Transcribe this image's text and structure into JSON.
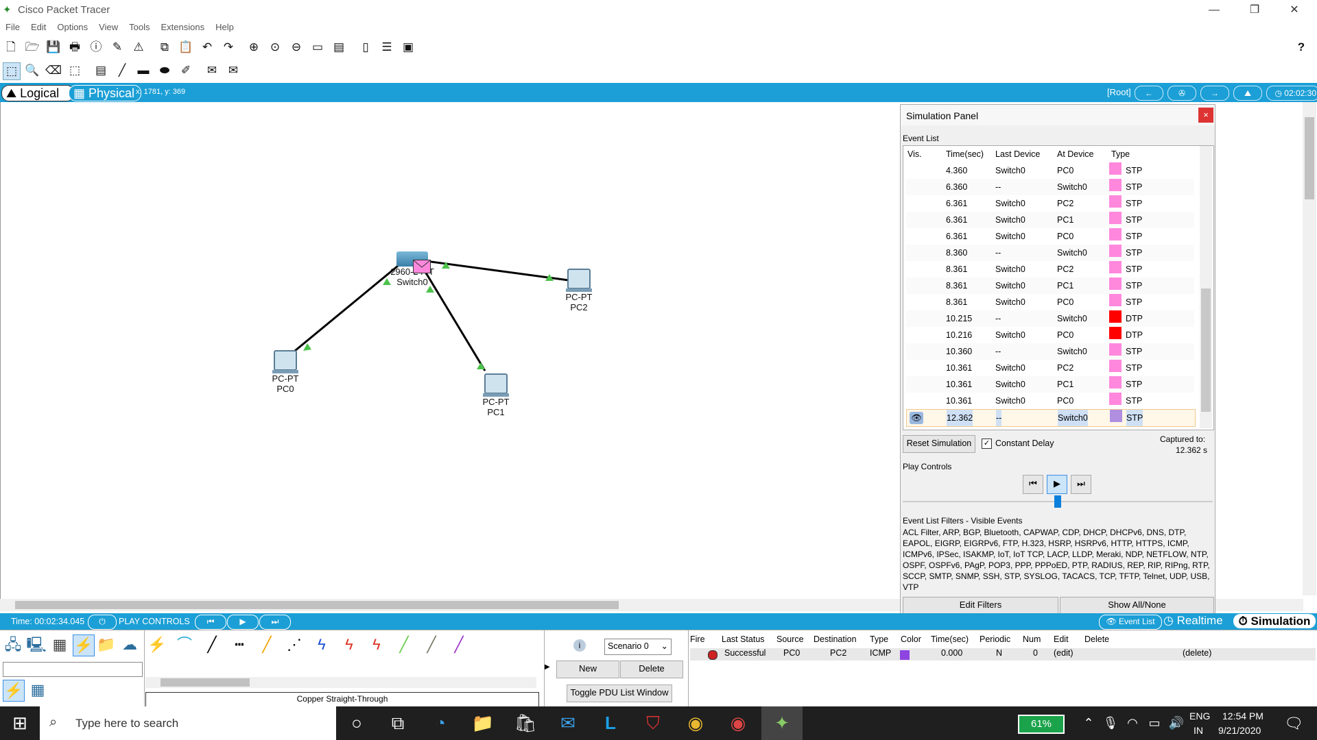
{
  "window": {
    "title": "Cisco Packet Tracer",
    "minimize_glyph": "—",
    "restore_glyph": "❐",
    "close_glyph": "✕"
  },
  "menu": [
    "File",
    "Edit",
    "Options",
    "View",
    "Tools",
    "Extensions",
    "Help"
  ],
  "main_toolbar_icons": [
    "new-file-icon",
    "open-icon",
    "save-icon",
    "print-icon",
    "info-icon",
    "activity-wizard-icon",
    "custom-device-icon",
    "copy-icon",
    "paste-icon",
    "undo-icon",
    "redo-icon",
    "zoom-in-icon",
    "zoom-reset-icon",
    "zoom-out-icon",
    "drawing-palette-icon",
    "device-dialog-icon",
    "document-icon",
    "viewport-icon",
    "network-info-icon"
  ],
  "help_glyph": "?",
  "second_toolbar_icons": [
    "select-icon",
    "inspect-icon",
    "delete-icon",
    "resize-icon",
    "note-icon",
    "line-icon",
    "rectangle-icon",
    "ellipse-icon",
    "freeform-icon",
    "add-pdu-icon",
    "add-complex-pdu-icon"
  ],
  "modebar": {
    "logical": "Logical",
    "physical": "Physical",
    "coords": "x: 1781, y: 369",
    "root": "[Root]",
    "clock": "02:02:30"
  },
  "topology": {
    "switch": {
      "model": "2960-24TT",
      "name": "Switch0"
    },
    "pcs": [
      {
        "type": "PC-PT",
        "name": "PC0"
      },
      {
        "type": "PC-PT",
        "name": "PC1"
      },
      {
        "type": "PC-PT",
        "name": "PC2"
      }
    ]
  },
  "sim_panel": {
    "title": "Simulation Panel",
    "event_list_label": "Event List",
    "columns": [
      "Vis.",
      "Time(sec)",
      "Last Device",
      "At Device",
      "Type"
    ],
    "events": [
      {
        "time": "4.360",
        "last": "Switch0",
        "at": "PC0",
        "type": "STP",
        "color": "#ff88dd"
      },
      {
        "time": "6.360",
        "last": "--",
        "at": "Switch0",
        "type": "STP",
        "color": "#ff88dd"
      },
      {
        "time": "6.361",
        "last": "Switch0",
        "at": "PC2",
        "type": "STP",
        "color": "#ff88dd"
      },
      {
        "time": "6.361",
        "last": "Switch0",
        "at": "PC1",
        "type": "STP",
        "color": "#ff88dd"
      },
      {
        "time": "6.361",
        "last": "Switch0",
        "at": "PC0",
        "type": "STP",
        "color": "#ff88dd"
      },
      {
        "time": "8.360",
        "last": "--",
        "at": "Switch0",
        "type": "STP",
        "color": "#ff88dd"
      },
      {
        "time": "8.361",
        "last": "Switch0",
        "at": "PC2",
        "type": "STP",
        "color": "#ff88dd"
      },
      {
        "time": "8.361",
        "last": "Switch0",
        "at": "PC1",
        "type": "STP",
        "color": "#ff88dd"
      },
      {
        "time": "8.361",
        "last": "Switch0",
        "at": "PC0",
        "type": "STP",
        "color": "#ff88dd"
      },
      {
        "time": "10.215",
        "last": "--",
        "at": "Switch0",
        "type": "DTP",
        "color": "#ff0000"
      },
      {
        "time": "10.216",
        "last": "Switch0",
        "at": "PC0",
        "type": "DTP",
        "color": "#ff0000"
      },
      {
        "time": "10.360",
        "last": "--",
        "at": "Switch0",
        "type": "STP",
        "color": "#ff88dd"
      },
      {
        "time": "10.361",
        "last": "Switch0",
        "at": "PC2",
        "type": "STP",
        "color": "#ff88dd"
      },
      {
        "time": "10.361",
        "last": "Switch0",
        "at": "PC1",
        "type": "STP",
        "color": "#ff88dd"
      },
      {
        "time": "10.361",
        "last": "Switch0",
        "at": "PC0",
        "type": "STP",
        "color": "#ff88dd"
      },
      {
        "time": "12.362",
        "last": "--",
        "at": "Switch0",
        "type": "STP",
        "color": "#b08ee0",
        "selected": true
      }
    ],
    "reset_label": "Reset Simulation",
    "constant_delay_label": "Constant Delay",
    "constant_delay_checked": true,
    "captured_label": "Captured to:",
    "captured_value": "12.362 s",
    "play_controls_label": "Play Controls",
    "filters_title": "Event List Filters - Visible Events",
    "filters_text": "ACL Filter, ARP, BGP, Bluetooth, CAPWAP, CDP, DHCP, DHCPv6, DNS, DTP, EAPOL, EIGRP, EIGRPv6, FTP, H.323, HSRP, HSRPv6, HTTP, HTTPS, ICMP, ICMPv6, IPSec, ISAKMP, IoT, IoT TCP, LACP, LLDP, Meraki, NDP, NETFLOW, NTP, OSPF, OSPFv6, PAgP, POP3, PPP, PPPoED, PTP, RADIUS, REP, RIP, RIPng, RTP, SCCP, SMTP, SNMP, SSH, STP, SYSLOG, TACACS, TCP, TFTP, Telnet, UDP, USB, VTP",
    "edit_filters_label": "Edit Filters",
    "show_all_label": "Show All/None",
    "close_glyph": "×"
  },
  "statusbar": {
    "time": "Time: 00:02:34.045",
    "play_controls": "PLAY CONTROLS",
    "event_list": "Event List",
    "realtime": "Realtime",
    "simulation": "Simulation"
  },
  "bottom": {
    "cable_label": "Copper Straight-Through",
    "scenario": "Scenario 0",
    "new_label": "New",
    "delete_label": "Delete",
    "toggle_label": "Toggle PDU List Window",
    "pdu_columns": [
      "Fire",
      "Last Status",
      "Source",
      "Destination",
      "Type",
      "Color",
      "Time(sec)",
      "Periodic",
      "Num",
      "Edit",
      "Delete"
    ],
    "pdu_row": {
      "status": "Successful",
      "source": "PC0",
      "destination": "PC2",
      "type": "ICMP",
      "color": "#8e44e0",
      "time": "0.000",
      "periodic": "N",
      "num": "0",
      "edit": "(edit)",
      "delete": "(delete)"
    }
  },
  "taskbar": {
    "search_placeholder": "Type here to search",
    "battery": "61%",
    "lang1": "ENG",
    "lang2": "IN",
    "time": "12:54 PM",
    "date": "9/21/2020"
  }
}
